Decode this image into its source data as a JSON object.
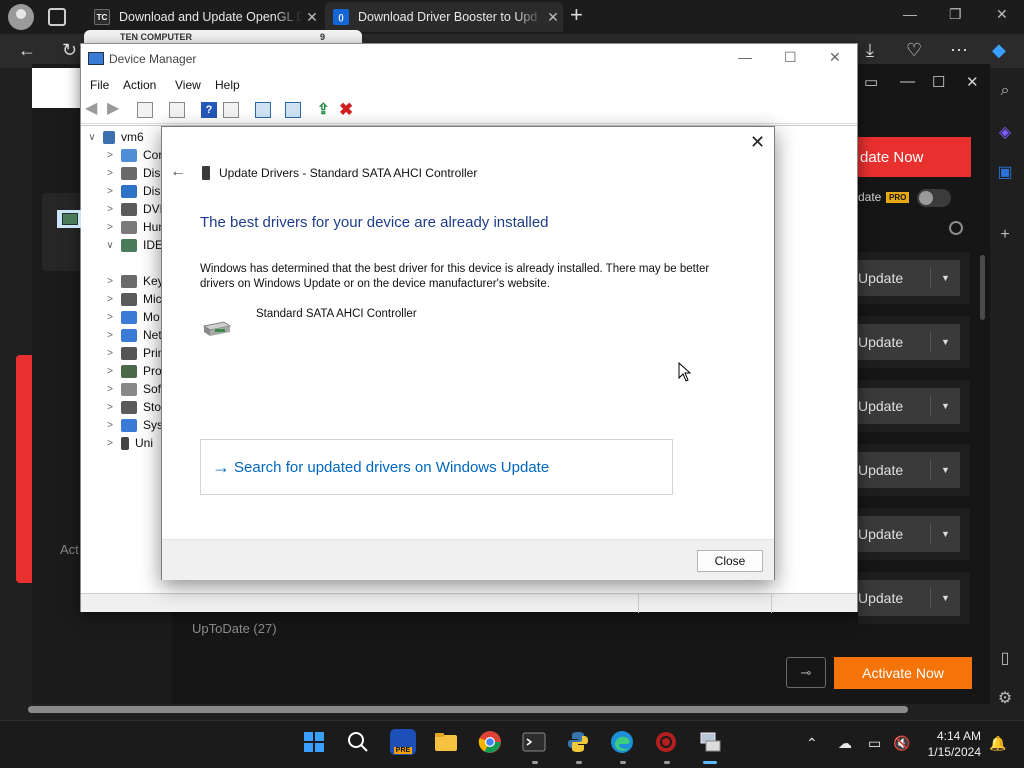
{
  "browser": {
    "tabs": [
      {
        "favicon": "TC",
        "title": "Download and Update OpenGL D"
      },
      {
        "favicon": "()",
        "title": "Download Driver Booster to Upd"
      }
    ],
    "popup_snippet": "TEN COMPUTER",
    "popup_snippet_suffix": "9"
  },
  "driver_booster": {
    "update_now": "date Now",
    "auto_update": "date",
    "pro_badge": "PRO",
    "rows": [
      {
        "label": "Update"
      },
      {
        "label": "Update"
      },
      {
        "label": "Update"
      },
      {
        "label": "Update"
      },
      {
        "label": "Update"
      },
      {
        "label": "Update"
      }
    ],
    "left_label": "Act",
    "up_to_date": "UpToDate (27)",
    "activate_now": "Activate Now"
  },
  "device_manager": {
    "title": "Device Manager",
    "menu": [
      "File",
      "Action",
      "View",
      "Help"
    ],
    "tree": [
      {
        "label": "vm6",
        "expander": "∨",
        "color": "#3c6fb0"
      },
      {
        "label": "Cor",
        "expander": ">",
        "color": "#4d8ed6"
      },
      {
        "label": "Disk",
        "expander": ">",
        "color": "#6a6a6a"
      },
      {
        "label": "Disp",
        "expander": ">",
        "color": "#2f73c9"
      },
      {
        "label": "DVD",
        "expander": ">",
        "color": "#5a5a5a"
      },
      {
        "label": "Hun",
        "expander": ">",
        "color": "#7a7a7a"
      },
      {
        "label": "IDE",
        "expander": "∨",
        "color": "#4a7a5a"
      },
      {
        "label": "Key",
        "expander": ">",
        "color": "#6a6a6a"
      },
      {
        "label": "Mic",
        "expander": ">",
        "color": "#5a5a5a"
      },
      {
        "label": "Mo",
        "expander": ">",
        "color": "#3a7bd5"
      },
      {
        "label": "Net",
        "expander": ">",
        "color": "#3a7bd5"
      },
      {
        "label": "Prin",
        "expander": ">",
        "color": "#555"
      },
      {
        "label": "Pro",
        "expander": ">",
        "color": "#4a6a4a"
      },
      {
        "label": "Soft",
        "expander": ">",
        "color": "#888"
      },
      {
        "label": "Stor",
        "expander": ">",
        "color": "#5a5a5a"
      },
      {
        "label": "Syst",
        "expander": ">",
        "color": "#3a7bd5"
      },
      {
        "label": "Uni",
        "expander": ">",
        "color": "#444"
      }
    ]
  },
  "update_dialog": {
    "header": "Update Drivers - Standard SATA AHCI Controller",
    "heading": "The best drivers for your device are already installed",
    "description": "Windows has determined that the best driver for this device is already installed. There may be better drivers on Windows Update or on the device manufacturer's website.",
    "device_name": "Standard SATA AHCI Controller",
    "search_link": "Search for updated drivers on Windows Update",
    "close_button": "Close"
  },
  "taskbar": {
    "time": "4:14 AM",
    "date": "1/15/2024",
    "apps": [
      "start-icon",
      "search-icon",
      "driver-booster-icon",
      "file-explorer-icon",
      "chrome-icon",
      "terminal-icon",
      "python-icon",
      "edge-icon",
      "security-icon",
      "device-manager-icon"
    ],
    "pre_badge": "PRE"
  },
  "colors": {
    "accent_red": "#e8302f",
    "activate_orange": "#f5740a",
    "link_blue": "#0067c0",
    "heading_blue": "#1f3d8a"
  }
}
